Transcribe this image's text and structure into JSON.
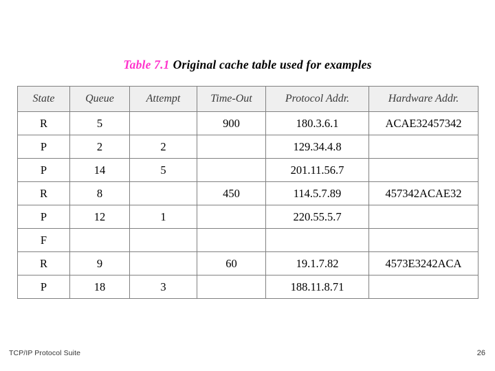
{
  "slide": {
    "title_label": "Table 7.1",
    "title_text": "Original cache table used for examples",
    "title_label_color": "#ff33cc",
    "footer_left": "TCP/IP Protocol Suite",
    "page_number": "26"
  },
  "table": {
    "headers": [
      "State",
      "Queue",
      "Attempt",
      "Time-Out",
      "Protocol Addr.",
      "Hardware Addr."
    ],
    "rows": [
      {
        "state": "R",
        "queue": "5",
        "attempt": "",
        "timeout": "900",
        "protocol": "180.3.6.1",
        "hardware": "ACAE32457342"
      },
      {
        "state": "P",
        "queue": "2",
        "attempt": "2",
        "timeout": "",
        "protocol": "129.34.4.8",
        "hardware": ""
      },
      {
        "state": "P",
        "queue": "14",
        "attempt": "5",
        "timeout": "",
        "protocol": "201.11.56.7",
        "hardware": ""
      },
      {
        "state": "R",
        "queue": "8",
        "attempt": "",
        "timeout": "450",
        "protocol": "114.5.7.89",
        "hardware": "457342ACAE32"
      },
      {
        "state": "P",
        "queue": "12",
        "attempt": "1",
        "timeout": "",
        "protocol": "220.55.5.7",
        "hardware": ""
      },
      {
        "state": "F",
        "queue": "",
        "attempt": "",
        "timeout": "",
        "protocol": "",
        "hardware": ""
      },
      {
        "state": "R",
        "queue": "9",
        "attempt": "",
        "timeout": "60",
        "protocol": "19.1.7.82",
        "hardware": "4573E3242ACA"
      },
      {
        "state": "P",
        "queue": "18",
        "attempt": "3",
        "timeout": "",
        "protocol": "188.11.8.71",
        "hardware": ""
      }
    ]
  }
}
